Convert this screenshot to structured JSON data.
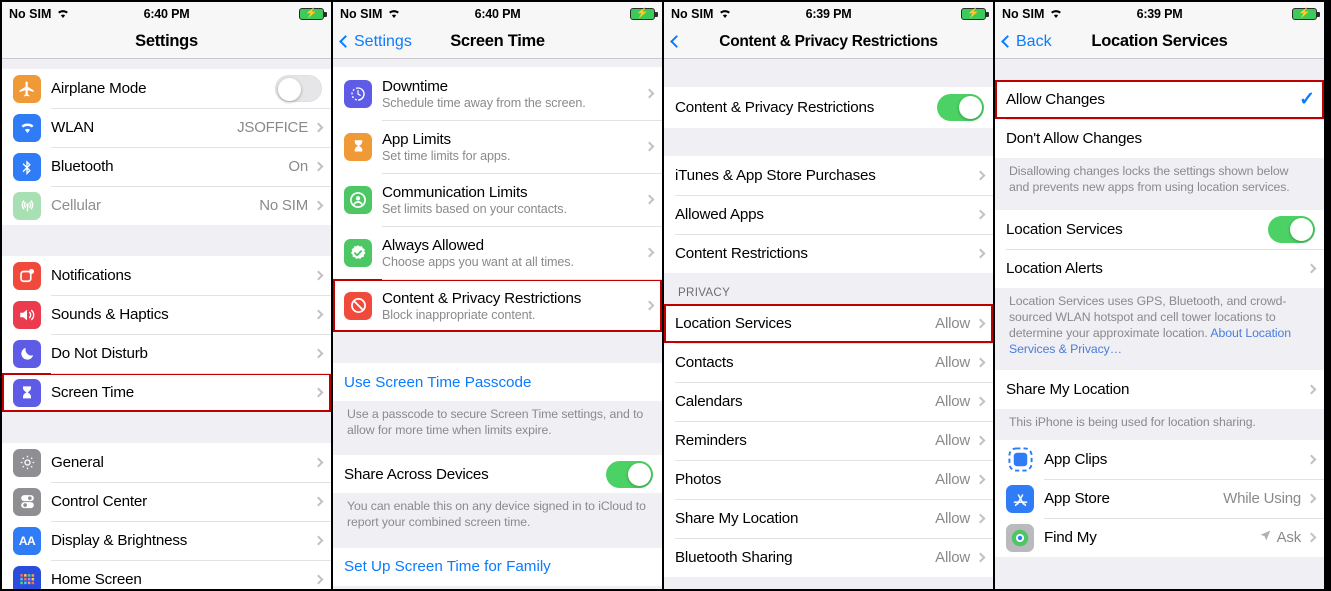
{
  "panels": [
    {
      "statusbar": {
        "carrier": "No SIM",
        "time": "6:40 PM"
      },
      "nav": {
        "back": "",
        "title": "Settings"
      },
      "groups": [
        {
          "rows": [
            {
              "icon": "airplane-icon",
              "label": "Airplane Mode",
              "control": "toggle-off"
            },
            {
              "icon": "wifi-icon",
              "label": "WLAN",
              "value": "JSOFFICE",
              "control": "chevron"
            },
            {
              "icon": "bluetooth-icon",
              "label": "Bluetooth",
              "value": "On",
              "control": "chevron"
            },
            {
              "icon": "cellular-icon",
              "label": "Cellular",
              "value": "No SIM",
              "control": "chevron",
              "dim": true
            }
          ]
        },
        {
          "rows": [
            {
              "icon": "notifications-icon",
              "label": "Notifications",
              "control": "chevron"
            },
            {
              "icon": "sounds-icon",
              "label": "Sounds & Haptics",
              "control": "chevron"
            },
            {
              "icon": "moon-icon",
              "label": "Do Not Disturb",
              "control": "chevron"
            },
            {
              "icon": "screentime-icon",
              "label": "Screen Time",
              "control": "chevron",
              "highlight": true
            }
          ]
        },
        {
          "rows": [
            {
              "icon": "gear-icon",
              "label": "General",
              "control": "chevron"
            },
            {
              "icon": "control-center-icon",
              "label": "Control Center",
              "control": "chevron"
            },
            {
              "icon": "display-icon",
              "label": "Display & Brightness",
              "control": "chevron"
            },
            {
              "icon": "home-screen-icon",
              "label": "Home Screen",
              "control": "chevron"
            }
          ]
        }
      ]
    },
    {
      "statusbar": {
        "carrier": "No SIM",
        "time": "6:40 PM"
      },
      "nav": {
        "back": "Settings",
        "title": "Screen Time"
      },
      "rows": [
        {
          "icon": "downtime-icon",
          "label": "Downtime",
          "sub": "Schedule time away from the screen."
        },
        {
          "icon": "app-limits-icon",
          "label": "App Limits",
          "sub": "Set time limits for apps."
        },
        {
          "icon": "communication-limits-icon",
          "label": "Communication Limits",
          "sub": "Set limits based on your contacts."
        },
        {
          "icon": "always-allowed-icon",
          "label": "Always Allowed",
          "sub": "Choose apps you want at all times."
        },
        {
          "icon": "content-privacy-icon",
          "label": "Content & Privacy Restrictions",
          "sub": "Block inappropriate content.",
          "highlight": true
        }
      ],
      "passcode_link": "Use Screen Time Passcode",
      "passcode_footer": "Use a passcode to secure Screen Time settings, and to allow for more time when limits expire.",
      "share_label": "Share Across Devices",
      "share_footer": "You can enable this on any device signed in to iCloud to report your combined screen time.",
      "family_link": "Set Up Screen Time for Family"
    },
    {
      "statusbar": {
        "carrier": "No SIM",
        "time": "6:39 PM"
      },
      "nav": {
        "back": "",
        "title": "Content & Privacy Restrictions"
      },
      "master_label": "Content & Privacy Restrictions",
      "main_rows": [
        {
          "label": "iTunes & App Store Purchases"
        },
        {
          "label": "Allowed Apps"
        },
        {
          "label": "Content Restrictions"
        }
      ],
      "privacy_header": "PRIVACY",
      "privacy_rows": [
        {
          "label": "Location Services",
          "value": "Allow",
          "highlight": true
        },
        {
          "label": "Contacts",
          "value": "Allow"
        },
        {
          "label": "Calendars",
          "value": "Allow"
        },
        {
          "label": "Reminders",
          "value": "Allow"
        },
        {
          "label": "Photos",
          "value": "Allow"
        },
        {
          "label": "Share My Location",
          "value": "Allow"
        },
        {
          "label": "Bluetooth Sharing",
          "value": "Allow"
        }
      ]
    },
    {
      "statusbar": {
        "carrier": "No SIM",
        "time": "6:39 PM"
      },
      "nav": {
        "back": "Back",
        "title": "Location Services"
      },
      "allow_label": "Allow Changes",
      "dont_allow_label": "Don't Allow Changes",
      "changes_footer": "Disallowing changes locks the settings shown below and prevents new apps from using location services.",
      "loc_services_label": "Location Services",
      "loc_alerts_label": "Location Alerts",
      "loc_footer_text": "Location Services uses GPS, Bluetooth, and crowd-sourced WLAN hotspot and cell tower locations to determine your approximate location. ",
      "loc_footer_link": "About Location Services & Privacy…",
      "share_my_location_label": "Share My Location",
      "share_footer": "This iPhone is being used for location sharing.",
      "app_rows": [
        {
          "icon": "app-clips-icon",
          "label": "App Clips",
          "value": ""
        },
        {
          "icon": "app-store-icon",
          "label": "App Store",
          "value": "While Using"
        },
        {
          "icon": "find-my-icon",
          "label": "Find My",
          "value": "Ask",
          "arrow": true
        }
      ]
    }
  ],
  "colors": {
    "accent_blue": "#0a7cff",
    "toggle_green": "#4cd264",
    "highlight_red": "#c00000"
  }
}
